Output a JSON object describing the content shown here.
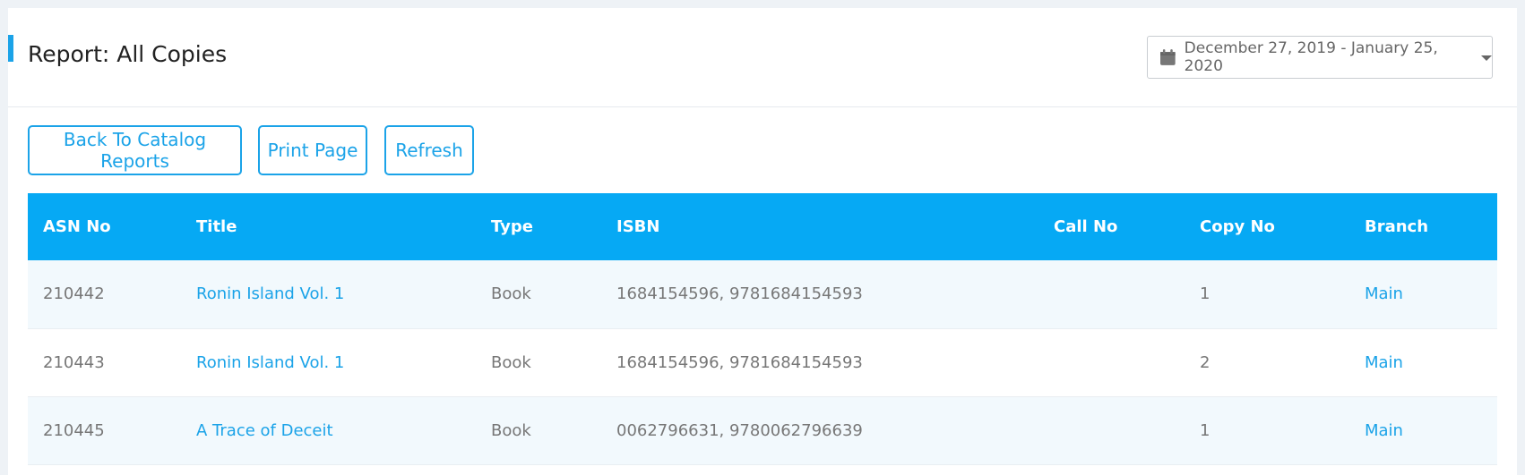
{
  "header": {
    "title": "Report: All Copies",
    "date_range": "December 27, 2019 - January 25, 2020",
    "accent_color": "#1ba3e8"
  },
  "toolbar": {
    "back_label": "Back To Catalog Reports",
    "print_label": "Print Page",
    "refresh_label": "Refresh"
  },
  "table": {
    "header_color": "#06a9f4",
    "columns": [
      "ASN No",
      "Title",
      "Type",
      "ISBN",
      "Call No",
      "Copy No",
      "Branch"
    ],
    "rows": [
      {
        "asn": "210442",
        "title": "Ronin Island Vol. 1",
        "type": "Book",
        "isbn": "1684154596, 9781684154593",
        "call_no": "",
        "copy_no": "1",
        "branch": "Main"
      },
      {
        "asn": "210443",
        "title": "Ronin Island Vol. 1",
        "type": "Book",
        "isbn": "1684154596, 9781684154593",
        "call_no": "",
        "copy_no": "2",
        "branch": "Main"
      },
      {
        "asn": "210445",
        "title": "A Trace of Deceit",
        "type": "Book",
        "isbn": "0062796631, 9780062796639",
        "call_no": "",
        "copy_no": "1",
        "branch": "Main"
      }
    ]
  },
  "icons": {
    "calendar": "calendar-icon",
    "dropdown": "caret-down-icon"
  }
}
